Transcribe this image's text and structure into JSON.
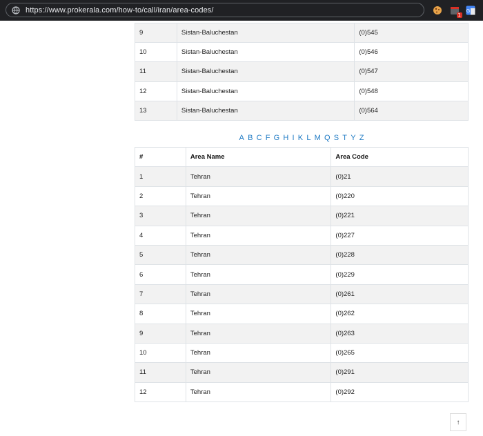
{
  "browser": {
    "url": "https://www.prokerala.com/how-to/call/iran/area-codes/"
  },
  "table_top": {
    "rows": [
      {
        "num": "9",
        "name": "Sistan-Baluchestan",
        "code": "(0)545"
      },
      {
        "num": "10",
        "name": "Sistan-Baluchestan",
        "code": "(0)546"
      },
      {
        "num": "11",
        "name": "Sistan-Baluchestan",
        "code": "(0)547"
      },
      {
        "num": "12",
        "name": "Sistan-Baluchestan",
        "code": "(0)548"
      },
      {
        "num": "13",
        "name": "Sistan-Baluchestan",
        "code": "(0)564"
      }
    ]
  },
  "alphabet": [
    "A",
    "B",
    "C",
    "F",
    "G",
    "H",
    "I",
    "K",
    "L",
    "M",
    "Q",
    "S",
    "T",
    "Y",
    "Z"
  ],
  "table_main": {
    "headers": {
      "num": "#",
      "name": "Area Name",
      "code": "Area Code"
    },
    "rows": [
      {
        "num": "1",
        "name": "Tehran",
        "code": "(0)21"
      },
      {
        "num": "2",
        "name": "Tehran",
        "code": "(0)220"
      },
      {
        "num": "3",
        "name": "Tehran",
        "code": "(0)221"
      },
      {
        "num": "4",
        "name": "Tehran",
        "code": "(0)227"
      },
      {
        "num": "5",
        "name": "Tehran",
        "code": "(0)228"
      },
      {
        "num": "6",
        "name": "Tehran",
        "code": "(0)229"
      },
      {
        "num": "7",
        "name": "Tehran",
        "code": "(0)261"
      },
      {
        "num": "8",
        "name": "Tehran",
        "code": "(0)262"
      },
      {
        "num": "9",
        "name": "Tehran",
        "code": "(0)263"
      },
      {
        "num": "10",
        "name": "Tehran",
        "code": "(0)265"
      },
      {
        "num": "11",
        "name": "Tehran",
        "code": "(0)291"
      },
      {
        "num": "12",
        "name": "Tehran",
        "code": "(0)292"
      }
    ]
  },
  "back_to_top": {
    "label": "↑"
  },
  "colors": {
    "topbar": "#202124",
    "link": "#1e7ac4",
    "stripe": "#f2f2f2",
    "border": "#dee2e6"
  }
}
